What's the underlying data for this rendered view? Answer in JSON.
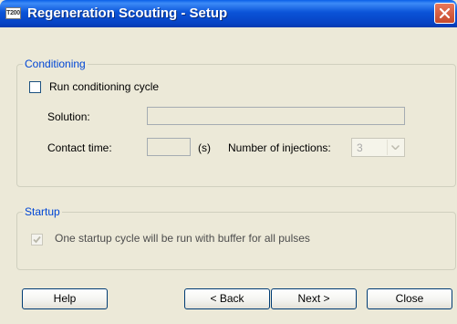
{
  "window": {
    "app_icon_label": "T200",
    "title": "Regeneration Scouting - Setup"
  },
  "conditioning": {
    "legend": "Conditioning",
    "run_checkbox_label": "Run conditioning cycle",
    "run_checked": false,
    "solution_label": "Solution:",
    "solution_value": "",
    "contact_time_label": "Contact time:",
    "contact_time_value": "",
    "contact_time_unit": "(s)",
    "injections_label": "Number of injections:",
    "injections_value": "3"
  },
  "startup": {
    "legend": "Startup",
    "checkbox_label": "One startup cycle will be run with buffer for all pulses",
    "checked": true
  },
  "buttons": {
    "help": "Help",
    "back": "< Back",
    "next": "Next >",
    "close": "Close"
  }
}
